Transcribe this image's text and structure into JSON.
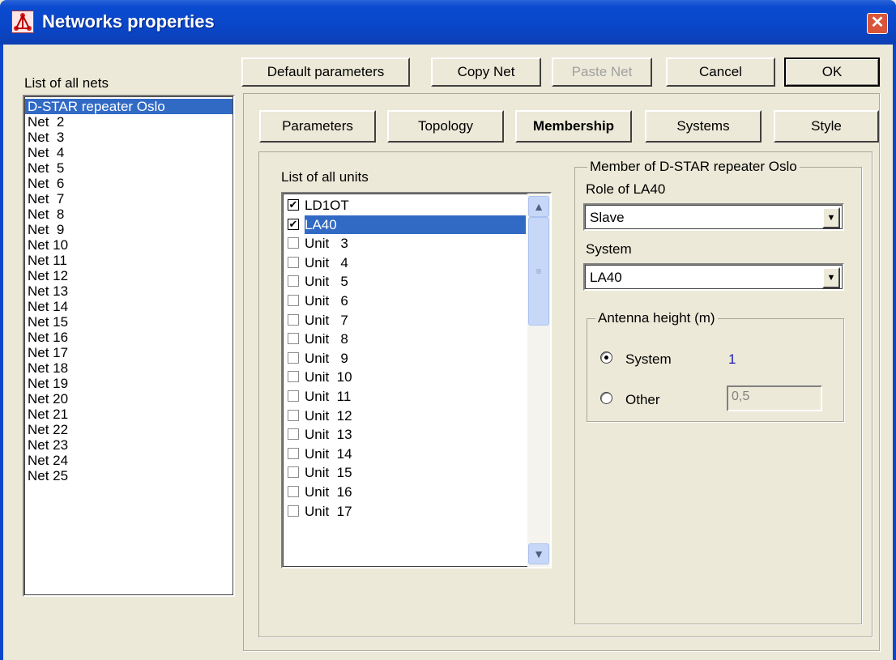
{
  "window": {
    "title": "Networks properties",
    "close_label": "✕"
  },
  "toolbar": {
    "default_parameters": "Default parameters",
    "copy_net": "Copy Net",
    "paste_net": "Paste Net",
    "cancel": "Cancel",
    "ok": "OK"
  },
  "nets": {
    "label": "List of all nets",
    "items": [
      "D-STAR repeater Oslo",
      "Net  2",
      "Net  3",
      "Net  4",
      "Net  5",
      "Net  6",
      "Net  7",
      "Net  8",
      "Net  9",
      "Net 10",
      "Net 11",
      "Net 12",
      "Net 13",
      "Net 14",
      "Net 15",
      "Net 16",
      "Net 17",
      "Net 18",
      "Net 19",
      "Net 20",
      "Net 21",
      "Net 22",
      "Net 23",
      "Net 24",
      "Net 25"
    ],
    "selected_index": 0
  },
  "tabs": [
    "Parameters",
    "Topology",
    "Membership",
    "Systems",
    "Style"
  ],
  "active_tab": "Membership",
  "units": {
    "label": "List of all units",
    "items": [
      {
        "name": "LD1OT",
        "checked": true
      },
      {
        "name": "LA40",
        "checked": true,
        "selected": true
      },
      {
        "name": "Unit   3",
        "checked": false
      },
      {
        "name": "Unit   4",
        "checked": false
      },
      {
        "name": "Unit   5",
        "checked": false
      },
      {
        "name": "Unit   6",
        "checked": false
      },
      {
        "name": "Unit   7",
        "checked": false
      },
      {
        "name": "Unit   8",
        "checked": false
      },
      {
        "name": "Unit   9",
        "checked": false
      },
      {
        "name": "Unit  10",
        "checked": false
      },
      {
        "name": "Unit  11",
        "checked": false
      },
      {
        "name": "Unit  12",
        "checked": false
      },
      {
        "name": "Unit  13",
        "checked": false
      },
      {
        "name": "Unit  14",
        "checked": false
      },
      {
        "name": "Unit  15",
        "checked": false
      },
      {
        "name": "Unit  16",
        "checked": false
      },
      {
        "name": "Unit  17",
        "checked": false
      }
    ]
  },
  "member": {
    "group_label": "Member of D-STAR repeater Oslo",
    "role_label": "Role of LA40",
    "role_value": "Slave",
    "system_label": "System",
    "system_value": "LA40",
    "antenna": {
      "group_label": "Antenna height (m)",
      "system_option": "System",
      "system_value": "1",
      "other_option": "Other",
      "other_value": "0,5",
      "selected": "System"
    }
  }
}
